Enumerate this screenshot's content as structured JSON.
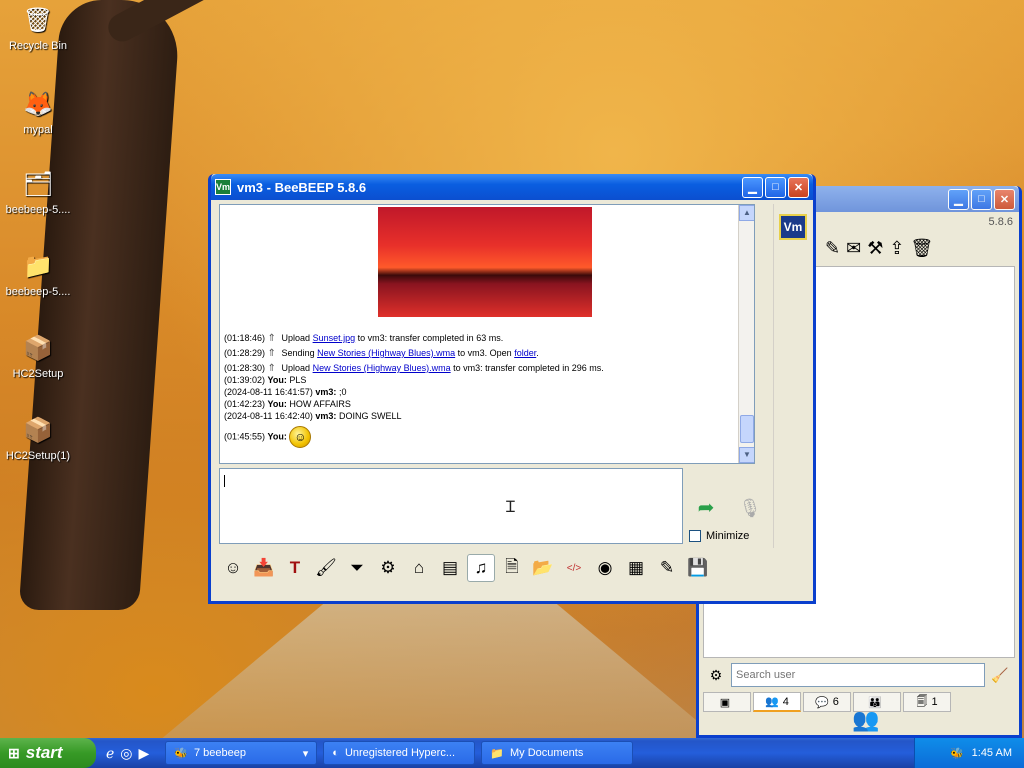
{
  "desktop": {
    "icons": [
      {
        "label": "Recycle Bin",
        "icon": "recycle-bin-icon",
        "glyph": "🗑"
      },
      {
        "label": "mypal",
        "icon": "mypal-icon",
        "glyph": "🦊"
      },
      {
        "label": "beebeep-5....",
        "icon": "zip-folder-icon",
        "glyph": "🗂"
      },
      {
        "label": "beebeep-5....",
        "icon": "folder-icon",
        "glyph": "📁"
      },
      {
        "label": "HC2Setup",
        "icon": "installer-icon",
        "glyph": "📦"
      },
      {
        "label": "HC2Setup(1)",
        "icon": "installer-icon",
        "glyph": "📦"
      }
    ]
  },
  "chat_window": {
    "title": "vm3 - BeeBEEP 5.8.6",
    "app_icon": "Vm",
    "avatar": "Vm",
    "log": {
      "l1_time": "(01:18:46)",
      "l1_pre": "Upload",
      "l1_link": "Sunset.jpg",
      "l1_post": "to vm3: transfer completed in 63 ms.",
      "l2_time": "(01:28:29)",
      "l2_pre": "Sending",
      "l2_link": "New Stories (Highway Blues).wma",
      "l2_mid": "to vm3. Open",
      "l2_link2": "folder",
      "l2_post": ".",
      "l3_time": "(01:28:30)",
      "l3_pre": "Upload",
      "l3_link": "New Stories (Highway Blues).wma",
      "l3_post": "to vm3: transfer completed in 296 ms.",
      "l4_time": "(01:39:02)",
      "l4_who": "You:",
      "l4_msg": "PLS",
      "l5_time": "(2024-08-11 16:41:57)",
      "l5_who": "vm3:",
      "l5_msg": ";0",
      "l6_time": "(01:42:23)",
      "l6_who": "You:",
      "l6_msg": "HOW AFFAIRS",
      "l7_time": "(2024-08-11 16:42:40)",
      "l7_who": "vm3:",
      "l7_msg": "DOING SWELL",
      "l8_time": "(01:45:55)",
      "l8_who": "You:"
    },
    "input_value": "",
    "minimize_label": "Minimize",
    "toolbar_icons": [
      "emoticon-icon",
      "send-file-icon",
      "font-icon",
      "color-icon",
      "filter-icon",
      "settings-icon",
      "save-chat-icon",
      "spellcheck-icon",
      "sound-icon",
      "share-file-icon",
      "share-folder-icon",
      "html-icon",
      "screenshot-icon",
      "clear-icon",
      "edit-icon",
      "save-icon"
    ]
  },
  "main_window": {
    "version": "5.8.6",
    "search_placeholder": "Search user",
    "tabs": [
      {
        "icon": "chat-tab-icon",
        "count": ""
      },
      {
        "icon": "users-tab-icon",
        "count": "4"
      },
      {
        "icon": "messages-tab-icon",
        "count": "6"
      },
      {
        "icon": "groups-tab-icon",
        "count": ""
      },
      {
        "icon": "files-tab-icon",
        "count": "1"
      }
    ]
  },
  "taskbar": {
    "start_label": "start",
    "tasks": [
      "7 beebeep",
      "Unregistered Hyperc...",
      "My Documents"
    ],
    "clock": "1:45 AM"
  },
  "colors": {
    "xp_blue": "#0a5ee0",
    "start_green": "#379a26",
    "link": "#0000cc"
  }
}
